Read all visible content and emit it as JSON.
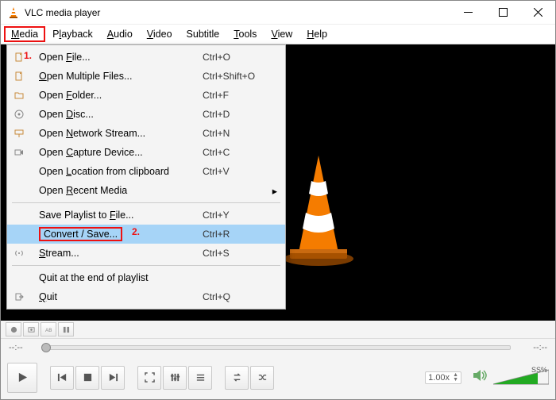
{
  "title": "VLC media player",
  "menubar": [
    {
      "label": "Media",
      "underline": "M",
      "highlight": true
    },
    {
      "label": "Playback",
      "underline": "l"
    },
    {
      "label": "Audio",
      "underline": "A"
    },
    {
      "label": "Video",
      "underline": "V"
    },
    {
      "label": "Subtitle",
      "underline": ""
    },
    {
      "label": "Tools",
      "underline": "T"
    },
    {
      "label": "View",
      "underline": "V"
    },
    {
      "label": "Help",
      "underline": "H"
    }
  ],
  "dropdown": [
    {
      "label": "Open File...",
      "under": "F",
      "accel": "Ctrl+O",
      "icon": "file"
    },
    {
      "label": "Open Multiple Files...",
      "under": "O",
      "accel": "Ctrl+Shift+O",
      "icon": "file"
    },
    {
      "label": "Open Folder...",
      "under": "F",
      "accel": "Ctrl+F",
      "icon": "folder"
    },
    {
      "label": "Open Disc...",
      "under": "D",
      "accel": "Ctrl+D",
      "icon": "disc"
    },
    {
      "label": "Open Network Stream...",
      "under": "N",
      "accel": "Ctrl+N",
      "icon": "net"
    },
    {
      "label": "Open Capture Device...",
      "under": "C",
      "accel": "Ctrl+C",
      "icon": "cap"
    },
    {
      "label": "Open Location from clipboard",
      "under": "L",
      "accel": "Ctrl+V"
    },
    {
      "label": "Open Recent Media",
      "under": "R",
      "submenu": true
    },
    {
      "sep": true
    },
    {
      "label": "Save Playlist to File...",
      "under": "F",
      "accel": "Ctrl+Y"
    },
    {
      "label": "Convert / Save...",
      "under": "R",
      "accel": "Ctrl+R",
      "highlight": true
    },
    {
      "label": "Stream...",
      "under": "S",
      "accel": "Ctrl+S",
      "icon": "stream"
    },
    {
      "sep": true
    },
    {
      "label": "Quit at the end of playlist"
    },
    {
      "label": "Quit",
      "under": "Q",
      "accel": "Ctrl+Q",
      "icon": "quit"
    }
  ],
  "annotations": {
    "n1": "1.",
    "n2": "2."
  },
  "seek": {
    "left": "--:--",
    "right": "--:--"
  },
  "speed": "1.00x",
  "volume": "SS%",
  "icons": {
    "play": "play",
    "prev": "prev",
    "stop": "stop",
    "next": "next",
    "fullscreen": "fullscreen",
    "extended": "extended",
    "playlist": "playlist",
    "loop": "loop",
    "shuffle": "shuffle",
    "record": "record",
    "snapshot": "snapshot",
    "atob": "atob",
    "frame": "frame",
    "speaker": "speaker"
  }
}
